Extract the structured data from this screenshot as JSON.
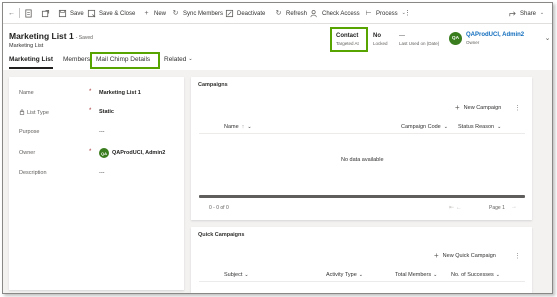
{
  "commandbar": {
    "save": "Save",
    "save_close": "Save & Close",
    "new": "New",
    "sync_members": "Sync Members",
    "deactivate": "Deactivate",
    "refresh": "Refresh",
    "check_access": "Check Access",
    "process": "Process",
    "share": "Share"
  },
  "header": {
    "title": "Marketing List 1",
    "saved": "- Saved",
    "subtitle": "Marketing List",
    "fields": [
      {
        "value": "Contact",
        "label": "Targeted At"
      },
      {
        "value": "No",
        "label": "Locked"
      },
      {
        "value": "---",
        "label": "Last Used on (Date)"
      }
    ],
    "owner": {
      "initials": "QA",
      "name": "QAProdUCI, Admin2",
      "label": "Owner"
    }
  },
  "tabs": [
    "Marketing List",
    "Members",
    "Mail Chimp Details",
    "Related"
  ],
  "form": {
    "fields": [
      {
        "label": "Name",
        "required": "*",
        "value": "Marketing List 1"
      },
      {
        "label": "List Type",
        "required": "*",
        "value": "Static"
      },
      {
        "label": "Purpose",
        "required": "",
        "value": "---"
      },
      {
        "label": "Owner",
        "required": "*",
        "value": "QAProdUCI, Admin2",
        "initials": "QA"
      },
      {
        "label": "Description",
        "required": "",
        "value": "---"
      }
    ]
  },
  "campaigns": {
    "title": "Campaigns",
    "new_label": "New Campaign",
    "columns": [
      "Name",
      "Campaign Code",
      "Status Reason"
    ],
    "empty": "No data available",
    "count": "0 - 0 of 0",
    "page": "Page 1"
  },
  "quick_campaigns": {
    "title": "Quick Campaigns",
    "new_label": "New Quick Campaign",
    "columns": [
      "Subject",
      "Activity Type",
      "Total Members",
      "No. of Successes"
    ]
  }
}
